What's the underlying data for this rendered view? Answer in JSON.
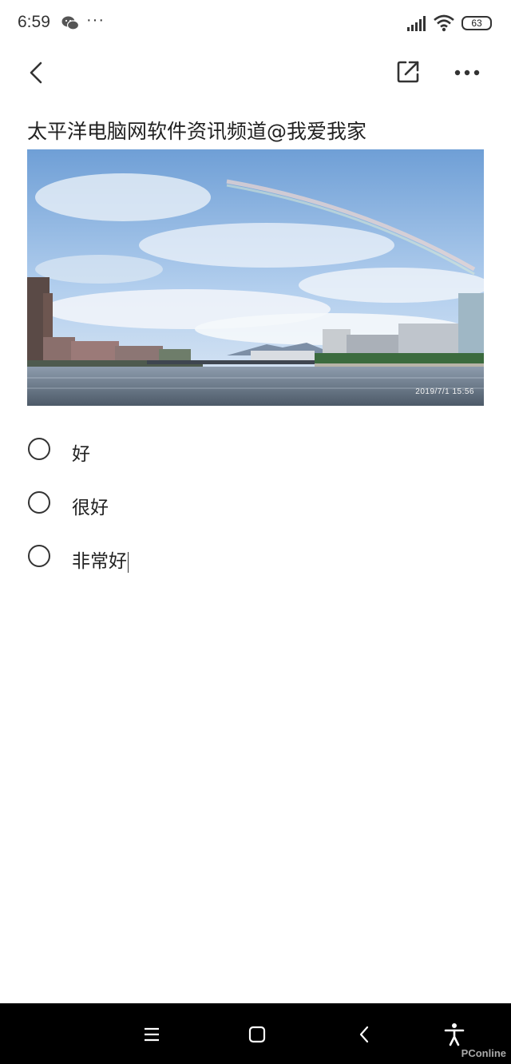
{
  "status_bar": {
    "time": "6:59",
    "more_indicator": "···",
    "battery": "63",
    "icons": [
      "wechat-icon",
      "signal-icon",
      "wifi-icon",
      "battery-icon"
    ]
  },
  "toolbar": {
    "back_icon": "chevron-left-icon",
    "share_icon": "share-external-icon",
    "menu_icon": "more-horizontal-icon"
  },
  "note": {
    "title": "太平洋电脑网软件资讯频道@我爱我家",
    "photo": {
      "timestamp": "2019/7/1  15:56"
    },
    "checklist": [
      {
        "label": "好",
        "checked": false
      },
      {
        "label": "很好",
        "checked": false
      },
      {
        "label": "非常好",
        "checked": false
      }
    ]
  },
  "system_nav": {
    "icons": [
      "menu-icon",
      "home-icon",
      "back-icon",
      "accessibility-icon"
    ],
    "watermark": "PConline"
  }
}
